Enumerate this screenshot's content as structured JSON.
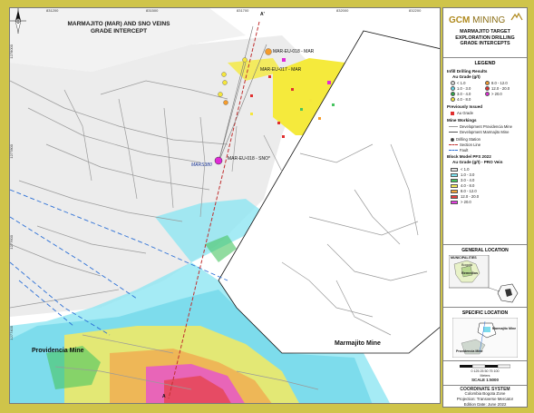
{
  "map": {
    "title_line1": "MARMAJITO (MAR) AND SNO VEINS",
    "title_line2": "GRADE INTERCEPT",
    "ticks_top": [
      "831200",
      "831500",
      "831700",
      "832000",
      "832200"
    ],
    "ticks_side": [
      "1278000",
      "1277800",
      "1277600",
      "1277400"
    ],
    "section_label_top": "A'",
    "section_label_bottom": "A",
    "intercepts": [
      {
        "label": "MAR-EU-018 - MAR"
      },
      {
        "label": "MAR-EU-017 - MAR"
      },
      {
        "label": "MAR-EU-018 - SNO*"
      }
    ],
    "station_label": "MARS380",
    "place_providencia": "Providencia Mine",
    "place_marmajito": "Marmajito Mine"
  },
  "panel": {
    "logo_gcm": "GCM",
    "logo_mining": "MINING",
    "title_line1": "MARMAJITO TARGET",
    "title_line2": "EXPLORATION DRILLING",
    "title_line3": "GRADE INTERCEPTS",
    "legend": {
      "title": "LEGEND",
      "infill_title": "Infill Drilling Results",
      "au_grade": "Au Grade (g/t)",
      "infill_classes": [
        {
          "label": "< 1.0",
          "color": "#d8d8d8"
        },
        {
          "label": "1.0 - 3.0",
          "color": "#66d7e8"
        },
        {
          "label": "3.0 - 4.0",
          "color": "#2fa84a"
        },
        {
          "label": "4.0 - 8.0",
          "color": "#f5e63c"
        },
        {
          "label": "8.0 - 12.0",
          "color": "#f59c2c"
        },
        {
          "label": "12.0 - 20.0",
          "color": "#e03030"
        },
        {
          "label": "> 20.0",
          "color": "#e02ad6"
        }
      ],
      "previous_title": "Previously Issued",
      "previous_item": "Au Grade",
      "workings_title": "Mine Workings",
      "workings_items": [
        "Development Providencia Mine",
        "Development Marmajito Mine"
      ],
      "drill_station": "Drilling Station",
      "section_line": "Section Line",
      "fault": "Fault",
      "block_title": "Block Model PFS 2022",
      "block_sub": "Au Grade (g/t) - PRO Vein",
      "block_classes": [
        {
          "label": "< 1.0",
          "color": "#e2e2e2"
        },
        {
          "label": "1.0 - 3.0",
          "color": "#7fe3f0"
        },
        {
          "label": "3.0 - 4.0",
          "color": "#47c460"
        },
        {
          "label": "4.0 - 8.0",
          "color": "#f7ec5a"
        },
        {
          "label": "8.0 - 12.0",
          "color": "#f7a83c"
        },
        {
          "label": "12.0 - 20.0",
          "color": "#e84040"
        },
        {
          "label": "> 20.0",
          "color": "#e43ee0"
        }
      ]
    },
    "general_location": "GENERAL LOCATION",
    "municipalities": "MUNICIPALITIES",
    "muni_bogota": "Bogotá",
    "muni_remedios": "Remedios",
    "specific_location": "SPECIFIC LOCATION",
    "spec_marmajito": "Marmajito Mine",
    "spec_providencia": "Providencia Mine",
    "scale_ticks": "0 125 25 50 75 100",
    "scale_unit": "Meters",
    "scale": "SCALE 1:5000",
    "coord_title": "COORDINATE SYSTEM",
    "coord_zone": "Colombia Bogota Zone",
    "coord_proj": "Projection: Transverse Mercator",
    "edition": "Edition Date: June 2022"
  },
  "colors": {
    "frame": "#cfc44a",
    "logo_gold": "#b08a1e",
    "section_line": "#c03030",
    "fault": "#2b6fd6"
  }
}
